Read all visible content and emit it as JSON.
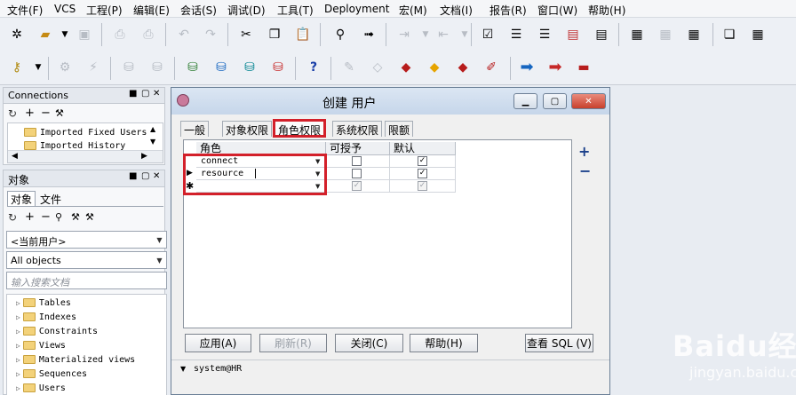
{
  "menu": [
    "文件(F)",
    "VCS",
    "工程(P)",
    "编辑(E)",
    "会话(S)",
    "调试(D)",
    "工具(T)",
    "Deployment",
    "宏(M)",
    "文档(I)",
    "报告(R)",
    "窗口(W)",
    "帮助(H)"
  ],
  "connections_panel": {
    "title": "Connections",
    "items": [
      "Imported Fixed Users",
      "Imported History"
    ]
  },
  "object_panel": {
    "title": "对象",
    "tabs": [
      "对象",
      "文件"
    ],
    "user_select": "<当前用户>",
    "type_select": "All objects",
    "search_placeholder": "输入搜索文档",
    "tree": [
      "Tables",
      "Indexes",
      "Constraints",
      "Views",
      "Materialized views",
      "Sequences",
      "Users"
    ]
  },
  "dialog": {
    "title": "创建 用户",
    "tabs": [
      "一般",
      "对象权限",
      "角色权限",
      "系统权限",
      "限额"
    ],
    "active_tab": "角色权限",
    "grid": {
      "headers": [
        "角色",
        "可授予",
        "默认"
      ],
      "rows": [
        {
          "role": "connect",
          "grantable": false,
          "default": true
        },
        {
          "role": "resource",
          "grantable": false,
          "default": true
        },
        {
          "role": "",
          "grantable": true,
          "default": true
        }
      ]
    },
    "add_label": "+",
    "remove_label": "−",
    "buttons": {
      "apply": "应用(A)",
      "refresh": "刷新(R)",
      "close": "关闭(C)",
      "help": "帮助(H)",
      "view_sql": "查看 SQL (V)"
    },
    "status": "system@HR"
  },
  "watermark": {
    "brand": "Baidu经验",
    "url": "jingyan.baidu.com"
  }
}
